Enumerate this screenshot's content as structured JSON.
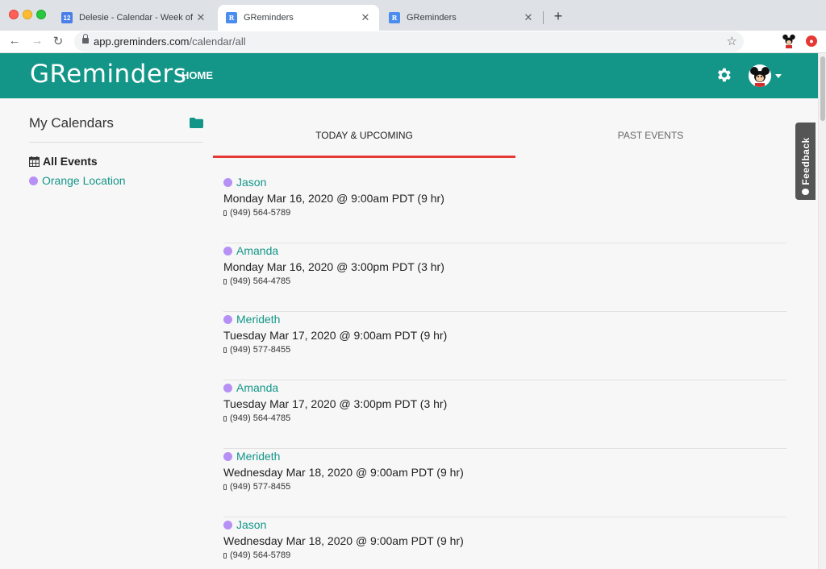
{
  "browser": {
    "tabs": [
      {
        "title": "Delesie - Calendar - Week of Ma",
        "favicon_text": "12",
        "active": false
      },
      {
        "title": "GReminders",
        "favicon_text": "R",
        "active": true
      },
      {
        "title": "GReminders",
        "favicon_text": "R",
        "active": false
      }
    ],
    "close_glyph": "✕",
    "newtab_glyph": "+",
    "back_glyph": "←",
    "forward_glyph": "→",
    "reload_glyph": "↻",
    "star_glyph": "☆",
    "url_host": "app.greminders.com",
    "url_path": "/calendar/all",
    "ext_badge": "●"
  },
  "app": {
    "logo": "GReminders",
    "nav_home": "HOME",
    "accent": "#139688"
  },
  "sidebar": {
    "title": "My Calendars",
    "all_events": "All Events",
    "orange_location": "Orange Location"
  },
  "tabs": {
    "today": "TODAY & UPCOMING",
    "past": "PAST EVENTS"
  },
  "events": [
    {
      "name": "Jason",
      "when": "Monday Mar 16, 2020 @ 9:00am PDT (9 hr)",
      "phone": "(949) 564-5789"
    },
    {
      "name": "Amanda",
      "when": "Monday Mar 16, 2020 @ 3:00pm PDT (3 hr)",
      "phone": "(949) 564-4785"
    },
    {
      "name": "Merideth",
      "when": "Tuesday Mar 17, 2020 @ 9:00am PDT (9 hr)",
      "phone": "(949) 577-8455"
    },
    {
      "name": "Amanda",
      "when": "Tuesday Mar 17, 2020 @ 3:00pm PDT (3 hr)",
      "phone": "(949) 564-4785"
    },
    {
      "name": "Merideth",
      "when": "Wednesday Mar 18, 2020 @ 9:00am PDT (9 hr)",
      "phone": "(949) 577-8455"
    },
    {
      "name": "Jason",
      "when": "Wednesday Mar 18, 2020 @ 9:00am PDT (9 hr)",
      "phone": "(949) 564-5789"
    }
  ],
  "feedback": "Feedback"
}
